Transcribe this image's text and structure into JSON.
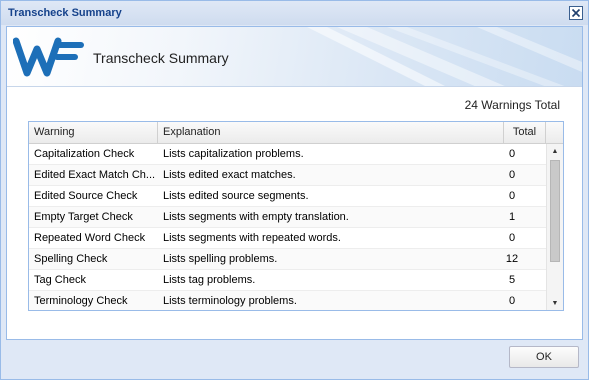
{
  "window": {
    "title": "Transcheck Summary"
  },
  "banner": {
    "title": "Transcheck Summary",
    "logo_text": "WF",
    "logo_color": "#1d6fb8"
  },
  "summary": {
    "warnings_total": "24 Warnings Total"
  },
  "grid": {
    "columns": [
      "Warning",
      "Explanation",
      "Total"
    ],
    "rows": [
      {
        "warning": "Capitalization Check",
        "explanation": "Lists capitalization problems.",
        "total": "0"
      },
      {
        "warning": "Edited Exact Match Ch...",
        "explanation": "Lists edited exact matches.",
        "total": "0"
      },
      {
        "warning": "Edited Source Check",
        "explanation": "Lists edited source segments.",
        "total": "0"
      },
      {
        "warning": "Empty Target Check",
        "explanation": "Lists segments with empty translation.",
        "total": "1"
      },
      {
        "warning": "Repeated Word Check",
        "explanation": "Lists segments with repeated words.",
        "total": "0"
      },
      {
        "warning": "Spelling Check",
        "explanation": "Lists spelling problems.",
        "total": "12"
      },
      {
        "warning": "Tag Check",
        "explanation": "Lists tag problems.",
        "total": "5"
      },
      {
        "warning": "Terminology Check",
        "explanation": "Lists terminology problems.",
        "total": "0"
      }
    ]
  },
  "footer": {
    "ok_label": "OK"
  },
  "colors": {
    "title_text": "#15428b",
    "frame_border": "#99bbe8",
    "frame_bg": "#dfe8f6"
  }
}
